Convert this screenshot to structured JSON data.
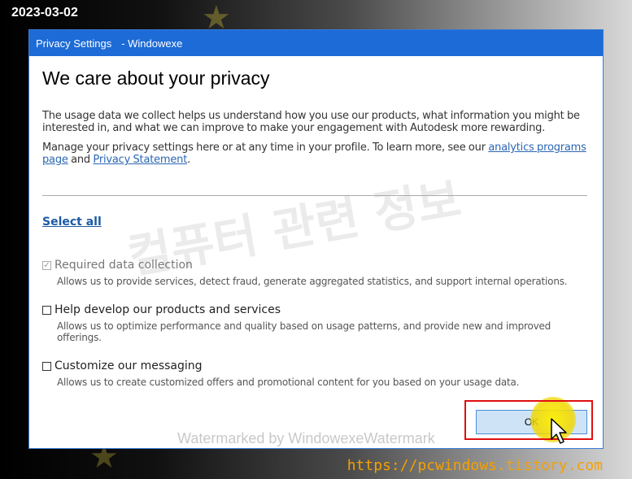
{
  "date_stamp": "2023-03-02",
  "site_url": "https://pcwindows.tistory.com",
  "window": {
    "title": "Privacy Settings",
    "app_name": "- Windowexe"
  },
  "dialog": {
    "heading": "We care about your privacy",
    "paragraph1": "The usage data we collect helps us understand how you use our products, what information you might be interested in, and what we can improve to make your engagement with Autodesk more rewarding.",
    "paragraph2_prefix": "Manage your privacy settings here or at any time in your profile. To learn more, see our ",
    "analytics_link": "analytics programs page",
    "paragraph2_and": " and ",
    "privacy_link": "Privacy Statement",
    "paragraph2_suffix": ".",
    "select_all": "Select all",
    "options": [
      {
        "label": "Required data collection",
        "description": "Allows us to provide services, detect fraud, generate aggregated statistics, and support internal operations.",
        "checked": true,
        "disabled": true
      },
      {
        "label": "Help develop our products and services",
        "description": "Allows us to optimize performance and quality based on usage patterns, and provide new and improved offerings.",
        "checked": false,
        "disabled": false
      },
      {
        "label": "Customize our messaging",
        "description": "Allows us to create customized offers and promotional content for you based on your usage data.",
        "checked": false,
        "disabled": false
      }
    ],
    "ok_label": "OK"
  },
  "watermarks": {
    "korean": "컴퓨터 관련 정보",
    "bottom": "Watermarked by WindowexeWatermark"
  },
  "colors": {
    "titlebar": "#1d6bd6",
    "link": "#2b67b3",
    "highlight": "#e01010",
    "url": "#f5a000"
  }
}
